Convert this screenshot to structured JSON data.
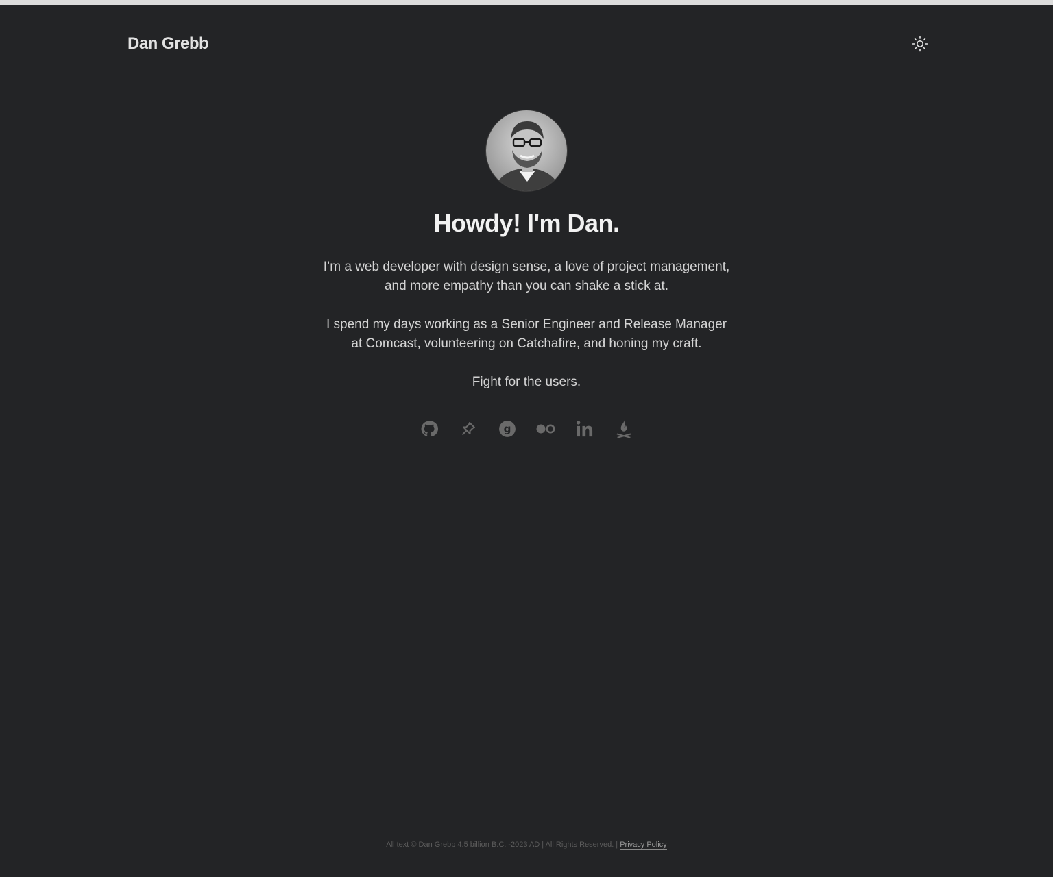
{
  "header": {
    "site_title": "Dan Grebb",
    "theme_toggle_icon": "sun-icon"
  },
  "profile": {
    "avatar_icon": "avatar-photo",
    "headline": "Howdy! I'm Dan."
  },
  "bio": {
    "intro": "I’m a web developer with design sense, a love of project management, and more empathy than you can shake a stick at.",
    "work_prefix": "I spend my days working as a Senior Engineer and Release Manager at ",
    "employer_link": "Comcast",
    "work_middle": ", volunteering on ",
    "volunteer_link": "Catchafire",
    "work_suffix": ", and honing my craft.",
    "tagline": "Fight for the users."
  },
  "social_links": [
    {
      "icon": "github-icon"
    },
    {
      "icon": "pinboard-icon"
    },
    {
      "icon": "goodreads-icon"
    },
    {
      "icon": "flickr-icon"
    },
    {
      "icon": "linkedin-icon"
    },
    {
      "icon": "campfire-icon"
    }
  ],
  "footer": {
    "copyright": "All text © Dan Grebb 4.5 billion B.C. -2023 AD | All Rights Reserved. | ",
    "privacy_link": "Privacy Policy"
  },
  "colors": {
    "background": "#232426",
    "text": "#d4d4d4",
    "icon": "#6a6a6a"
  }
}
